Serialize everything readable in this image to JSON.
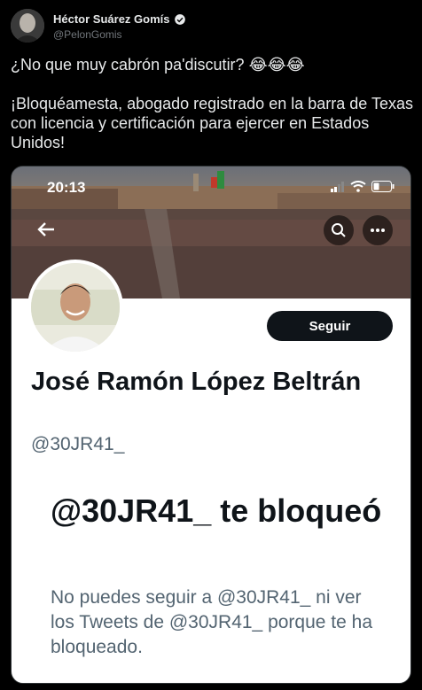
{
  "author": {
    "name": "Héctor Suárez Gomís",
    "handle": "@PelonGomis",
    "verified": true
  },
  "tweet": {
    "line1": "¿No que muy cabrón pa'discutir?  😂😂😂",
    "line2": "¡Bloquéamesta, abogado registrado en la barra de Texas con licencia y certificación para ejercer en Estados Unidos!"
  },
  "screenshot": {
    "status_time": "20:13",
    "follow_label": "Seguir",
    "profile_name": "José Ramón López Beltrán",
    "profile_handle": "@30JR41_",
    "blocked_title": "@30JR41_ te bloqueó",
    "blocked_desc": "No puedes seguir a @30JR41_ ni ver los Tweets de @30JR41_ porque te ha bloqueado."
  },
  "colors": {
    "background": "#000000",
    "verified": "#1d9bf0",
    "follow_button": "#0f1419"
  }
}
